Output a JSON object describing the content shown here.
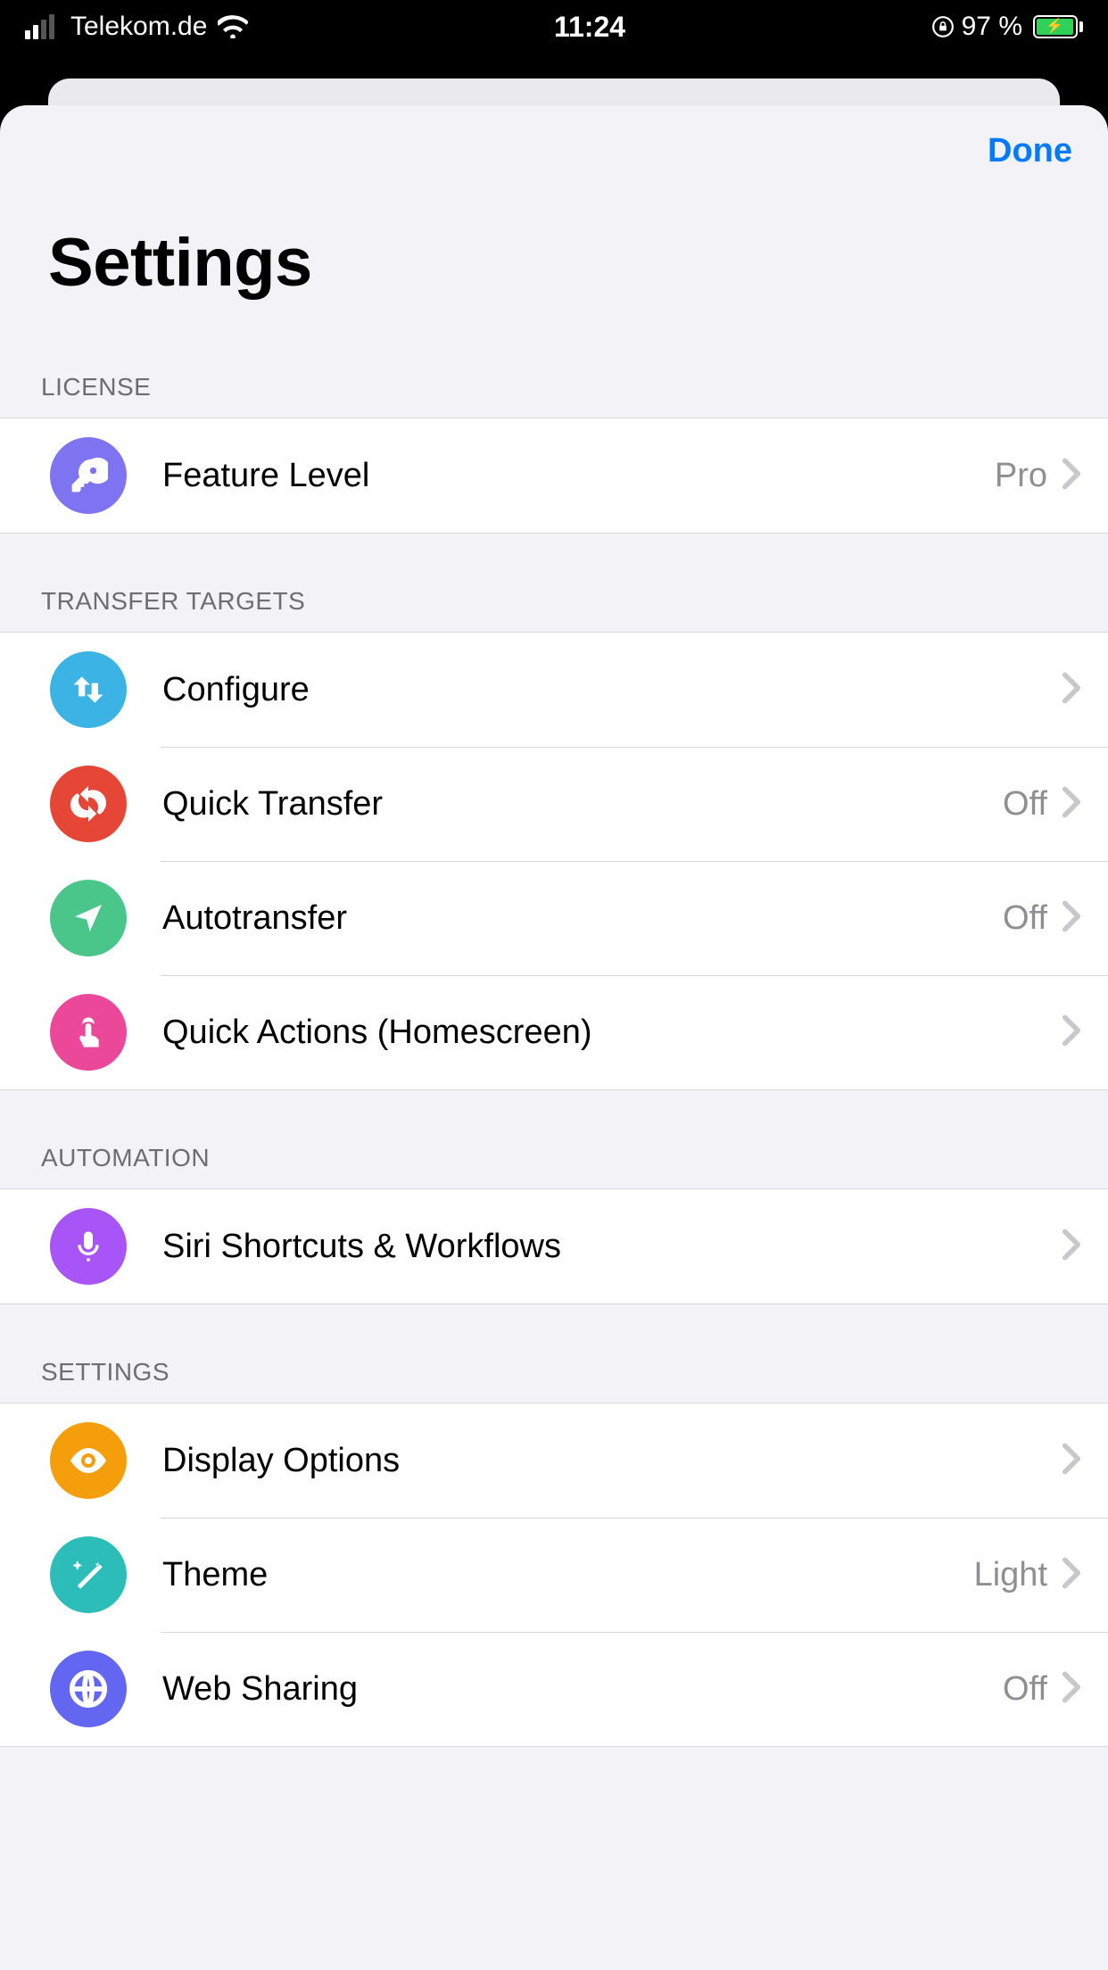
{
  "status": {
    "carrier": "Telekom.de",
    "time": "11:24",
    "battery_pct": "97 %"
  },
  "header": {
    "done": "Done",
    "title": "Settings"
  },
  "sections": {
    "license": {
      "header": "LICENSE",
      "feature_level": {
        "label": "Feature Level",
        "value": "Pro"
      }
    },
    "transfer": {
      "header": "TRANSFER TARGETS",
      "configure": {
        "label": "Configure"
      },
      "quick_transfer": {
        "label": "Quick Transfer",
        "value": "Off"
      },
      "autotransfer": {
        "label": "Autotransfer",
        "value": "Off"
      },
      "quick_actions": {
        "label": "Quick Actions (Homescreen)"
      }
    },
    "automation": {
      "header": "AUTOMATION",
      "siri": {
        "label": "Siri Shortcuts & Workflows"
      }
    },
    "settings": {
      "header": "SETTINGS",
      "display": {
        "label": "Display Options"
      },
      "theme": {
        "label": "Theme",
        "value": "Light"
      },
      "web_sharing": {
        "label": "Web Sharing",
        "value": "Off"
      }
    }
  }
}
